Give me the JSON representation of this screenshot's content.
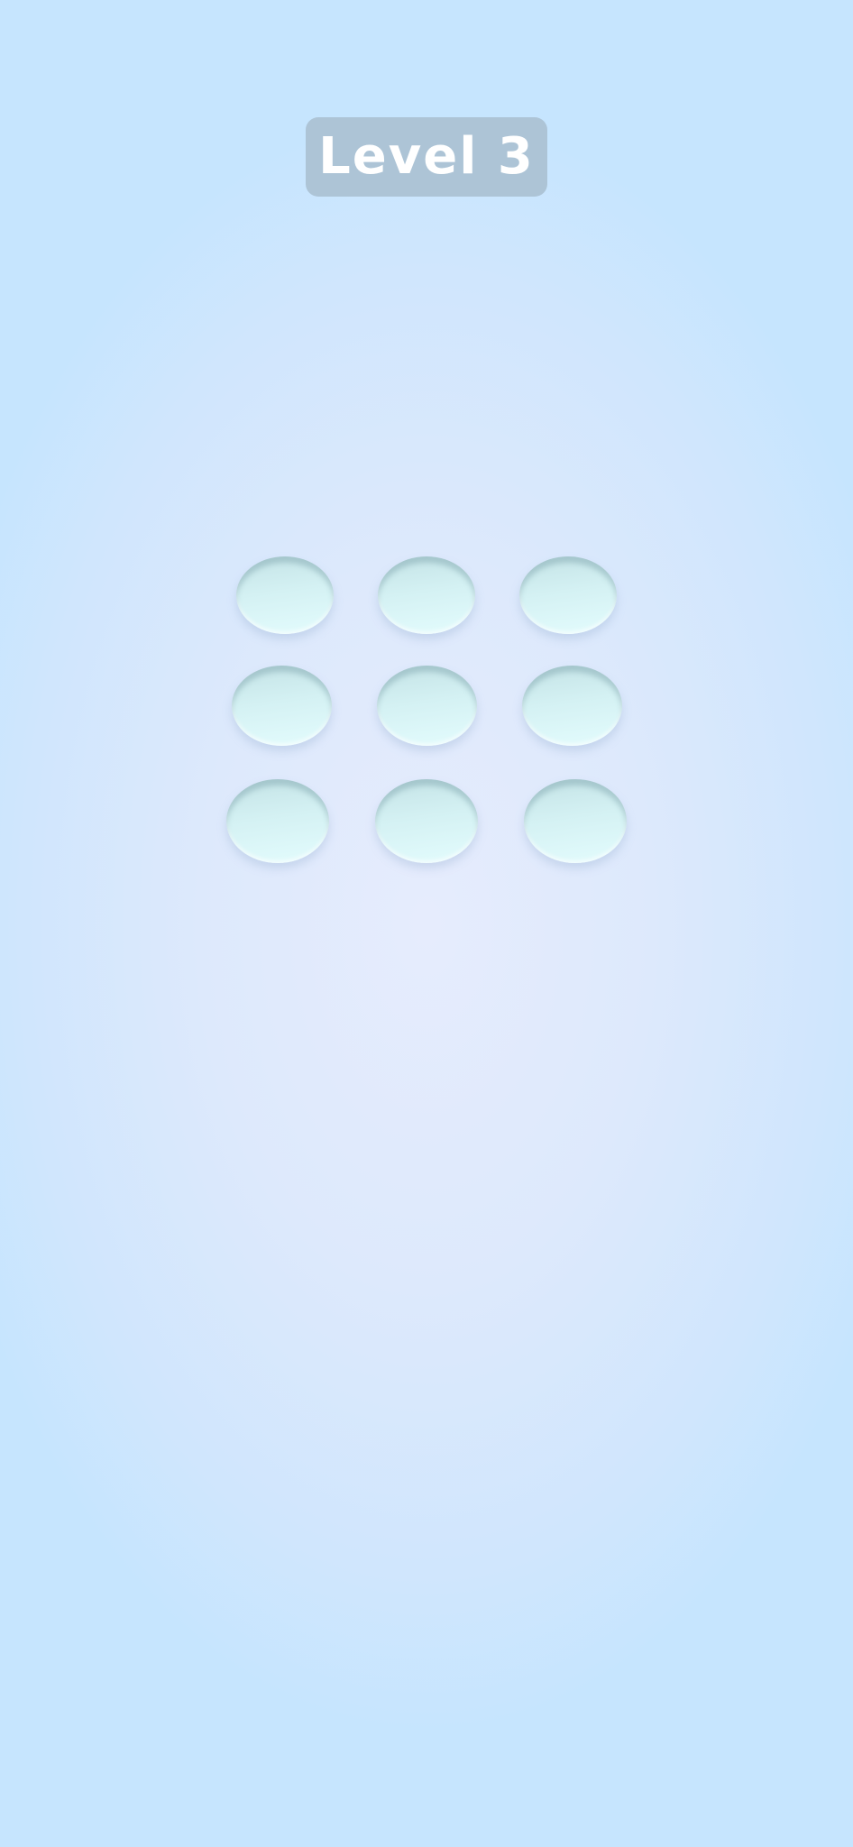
{
  "header": {
    "level_label": "Level 3"
  },
  "board": {
    "rows": 3,
    "columns": 3,
    "holes": [
      {
        "id": 1,
        "filled": false
      },
      {
        "id": 2,
        "filled": false
      },
      {
        "id": 3,
        "filled": false
      },
      {
        "id": 4,
        "filled": false
      },
      {
        "id": 5,
        "filled": false
      },
      {
        "id": 6,
        "filled": false
      },
      {
        "id": 7,
        "filled": false
      },
      {
        "id": 8,
        "filled": false
      },
      {
        "id": 9,
        "filled": false
      }
    ]
  },
  "colors": {
    "background": "#dde9fc",
    "badge": "#adc4d6",
    "badge_text": "#ffffff",
    "hole": "#d4f1f3"
  }
}
